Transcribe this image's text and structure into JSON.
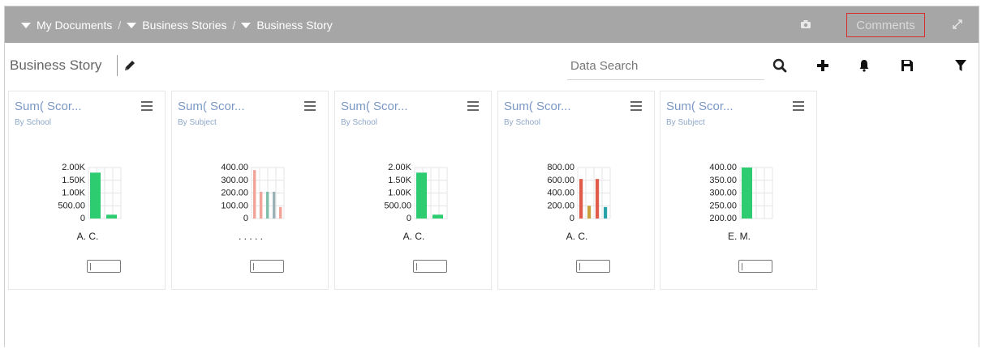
{
  "breadcrumb": [
    {
      "label": "My Documents"
    },
    {
      "label": "Business Stories"
    },
    {
      "label": "Business Story"
    }
  ],
  "breadcrumb_separator": "/",
  "header": {
    "comments_label": "Comments"
  },
  "toolbar": {
    "story_title": "Business Story",
    "search_placeholder": "Data Search"
  },
  "cards": [
    {
      "title": "Sum( Scor...",
      "subtitle": "By School",
      "category_label": "A. C.",
      "chart_data": {
        "type": "bar",
        "y_ticks": [
          "2.00K",
          "1.50K",
          "1.00K",
          "500.00",
          "0"
        ],
        "ylim": [
          0,
          2000
        ],
        "values": [
          1800,
          150
        ],
        "colors": [
          "#2ecc71",
          "#2ecc71"
        ]
      }
    },
    {
      "title": "Sum( Scor...",
      "subtitle": "By Subject",
      "category_label": ". . . . .",
      "chart_data": {
        "type": "bar",
        "y_ticks": [
          "400.00",
          "300.00",
          "200.00",
          "100.00",
          "0"
        ],
        "ylim": [
          0,
          400
        ],
        "values": [
          380,
          210,
          210,
          210,
          90
        ],
        "colors": [
          "#f0a49a",
          "#f0a49a",
          "#7fbfa8",
          "#9ab2b8",
          "#f0a49a"
        ]
      }
    },
    {
      "title": "Sum( Scor...",
      "subtitle": "By School",
      "category_label": "A. C.",
      "chart_data": {
        "type": "bar",
        "y_ticks": [
          "2.00K",
          "1.50K",
          "1.00K",
          "500.00",
          "0"
        ],
        "ylim": [
          0,
          2000
        ],
        "values": [
          1800,
          150
        ],
        "colors": [
          "#2ecc71",
          "#2ecc71"
        ]
      }
    },
    {
      "title": "Sum( Scor...",
      "subtitle": "By School",
      "category_label": "A. C.",
      "chart_data": {
        "type": "bar",
        "y_ticks": [
          "800.00",
          "600.00",
          "400.00",
          "200.00",
          "0"
        ],
        "ylim": [
          0,
          800
        ],
        "values": [
          620,
          200,
          620,
          180
        ],
        "colors": [
          "#e05b4a",
          "#c8a13a",
          "#e05b4a",
          "#2aa0a8"
        ]
      }
    },
    {
      "title": "Sum( Scor...",
      "subtitle": "By Subject",
      "category_label": "E. M.",
      "chart_data": {
        "type": "bar",
        "y_ticks": [
          "400.00",
          "350.00",
          "300.00",
          "250.00",
          "200.00"
        ],
        "ylim": [
          200,
          400
        ],
        "values": [
          400
        ],
        "colors": [
          "#2ecc71"
        ]
      }
    }
  ]
}
